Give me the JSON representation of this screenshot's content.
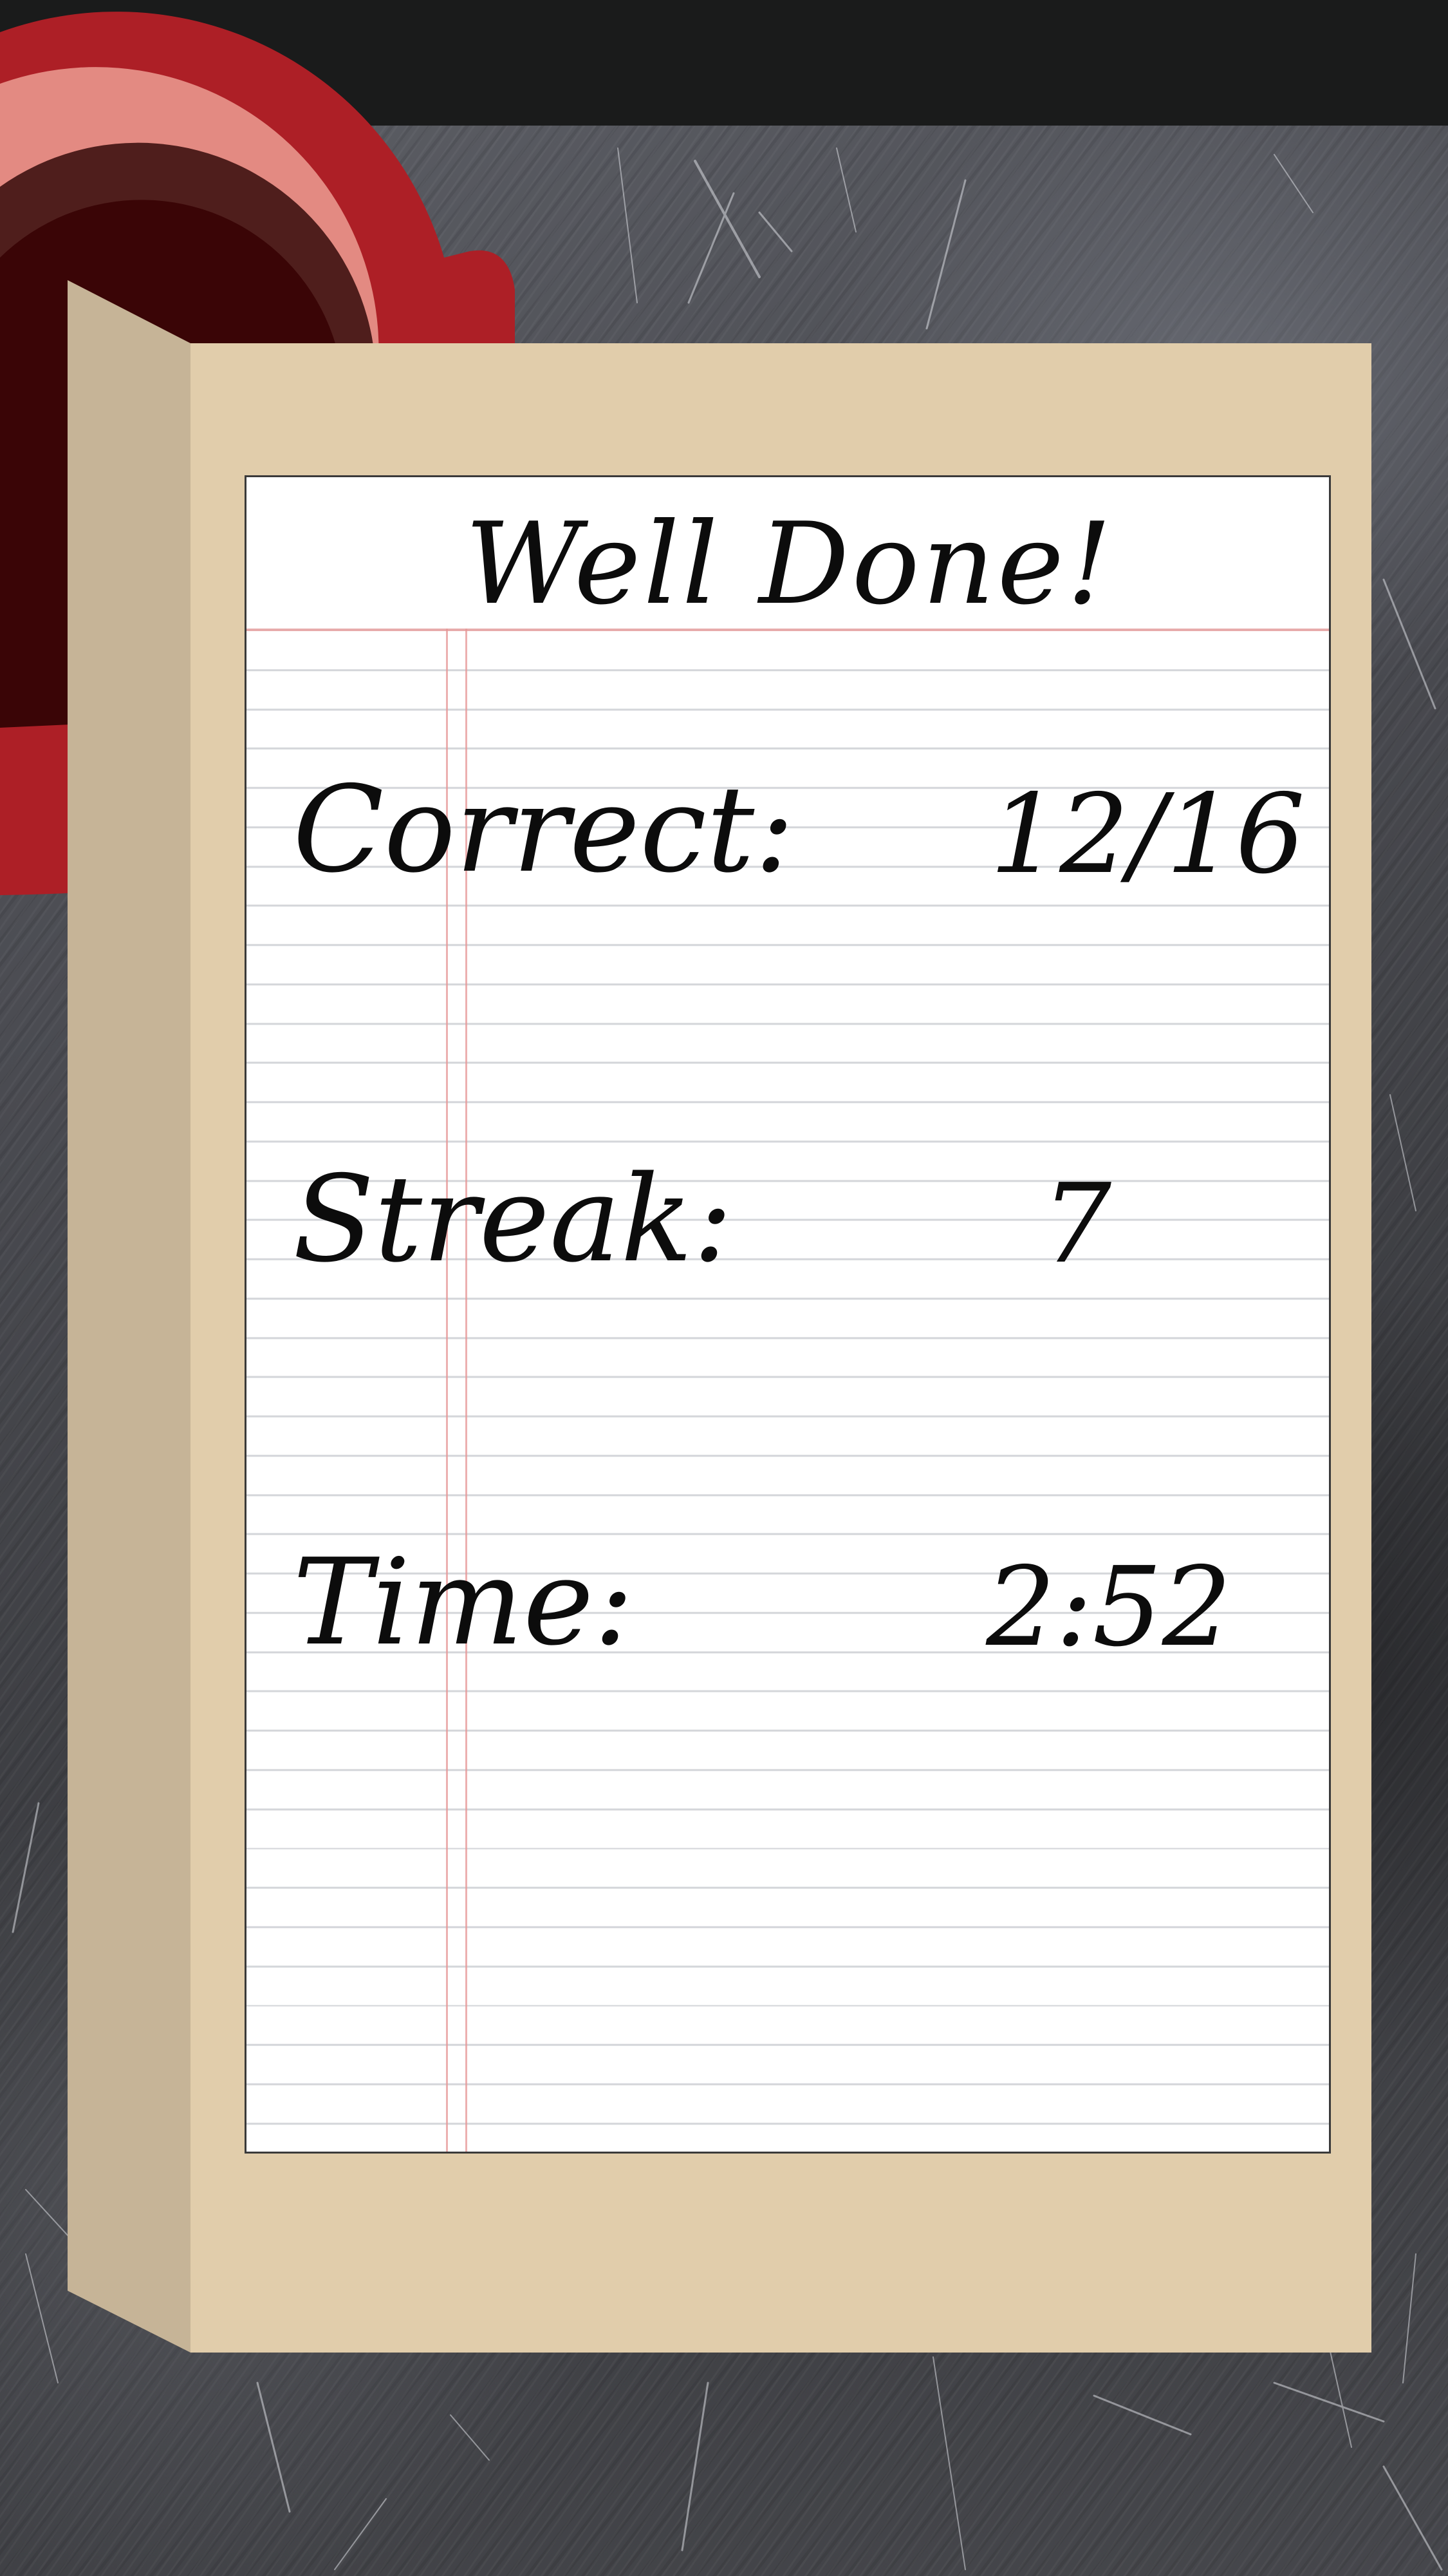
{
  "result_card": {
    "title": "Well Done!",
    "stats": {
      "correct": {
        "label": "Correct:",
        "value": "12/16"
      },
      "streak": {
        "label": "Streak:",
        "value": "7"
      },
      "time": {
        "label": "Time:",
        "value": "2:52"
      }
    }
  },
  "colors": {
    "top_bar": "#1a1b1b",
    "chalkboard": "#4a4b51",
    "board_front": "#e1cdab",
    "board_side": "#c6b497",
    "paper": "#ffffff",
    "ruled_line": "#d4d6da",
    "margin_line": "#e69696",
    "dial_outer": "#ad1f26",
    "dial_ring_light": "#e38a82",
    "dial_ring_dark": "#4f1e1c",
    "dial_center": "#3a0506",
    "text": "#0c0c0c"
  }
}
